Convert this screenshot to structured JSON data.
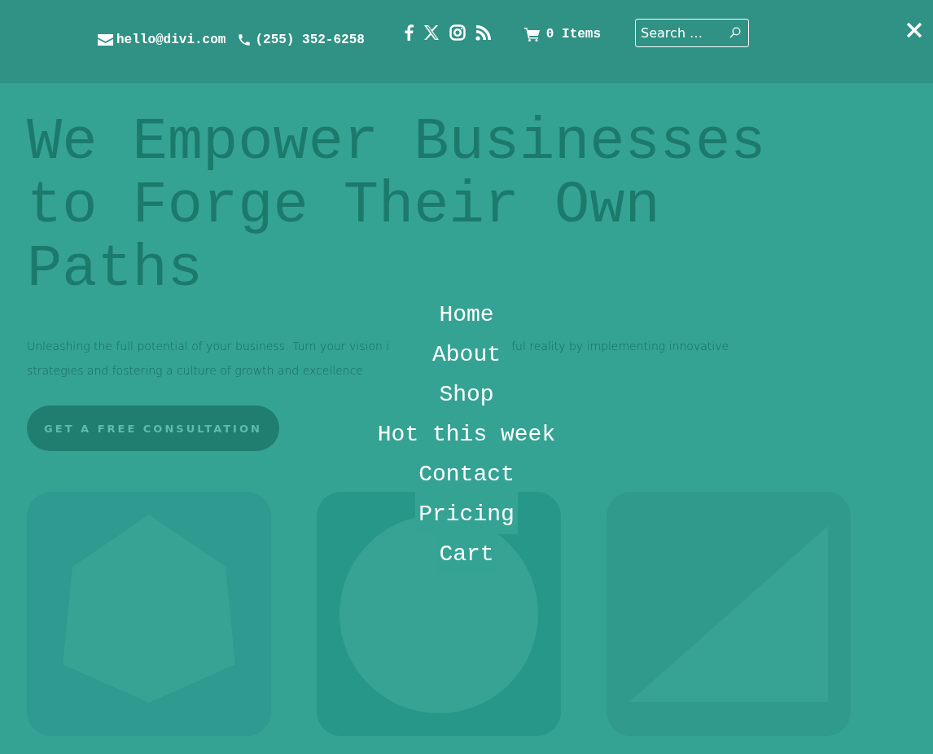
{
  "header": {
    "email": "hello@divi.com",
    "phone": "(255) 352-6258",
    "cart": "0 Items",
    "search": {
      "placeholder": "Search …"
    }
  },
  "hero": {
    "title": "We Empower Businesses to Forge Their Own Paths",
    "paragraph_lines": [
      [
        "Unleashing the full potential of your business. Turn your vision i",
        "ful reality by implementing innovative"
      ],
      [
        "strategies and fostering a culture of growth and excellence"
      ]
    ],
    "button": "GET A FREE CONSULTATION"
  },
  "cards": [
    {
      "kind": "hexagon"
    },
    {
      "kind": "circle"
    },
    {
      "kind": "triangle"
    }
  ],
  "menu": [
    "Home",
    "About",
    "Shop",
    "Hot this week",
    "Contact",
    "Pricing",
    "Cart"
  ]
}
